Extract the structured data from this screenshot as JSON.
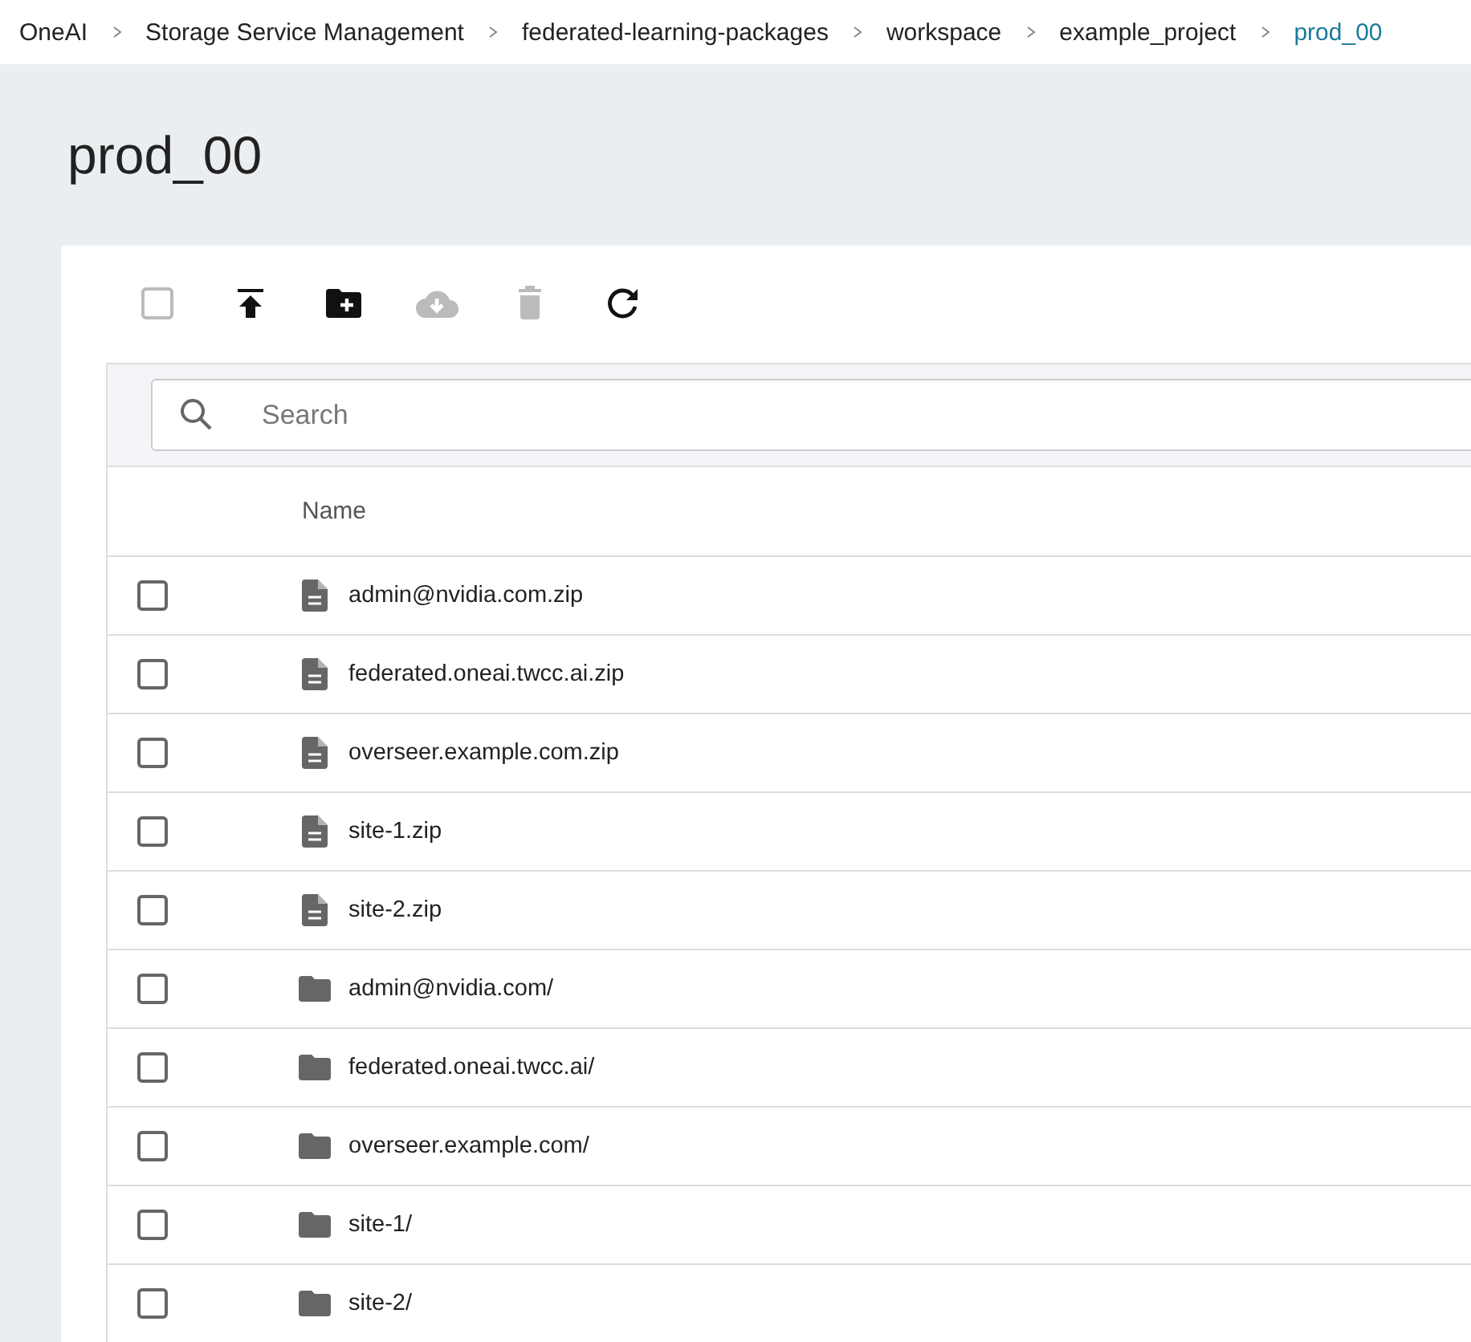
{
  "breadcrumb": [
    {
      "label": "OneAI",
      "current": false
    },
    {
      "label": "Storage Service Management",
      "current": false
    },
    {
      "label": "federated-learning-packages",
      "current": false
    },
    {
      "label": "workspace",
      "current": false
    },
    {
      "label": "example_project",
      "current": false
    },
    {
      "label": "prod_00",
      "current": true
    }
  ],
  "page_title": "prod_00",
  "toolbar": [
    {
      "kind": "select-all",
      "disabled": true,
      "checked": false
    },
    {
      "kind": "upload",
      "disabled": false
    },
    {
      "kind": "new-folder",
      "disabled": false
    },
    {
      "kind": "download",
      "disabled": true
    },
    {
      "kind": "delete",
      "disabled": true
    },
    {
      "kind": "refresh",
      "disabled": false
    }
  ],
  "search": {
    "placeholder": "Search"
  },
  "table": {
    "columns": [
      "Name"
    ],
    "rows": [
      {
        "name": "admin@nvidia.com.zip",
        "kind": "file",
        "checked": false
      },
      {
        "name": "federated.oneai.twcc.ai.zip",
        "kind": "file",
        "checked": false
      },
      {
        "name": "overseer.example.com.zip",
        "kind": "file",
        "checked": false
      },
      {
        "name": "site-1.zip",
        "kind": "file",
        "checked": false
      },
      {
        "name": "site-2.zip",
        "kind": "file",
        "checked": false
      },
      {
        "name": "admin@nvidia.com/",
        "kind": "folder",
        "checked": false
      },
      {
        "name": "federated.oneai.twcc.ai/",
        "kind": "folder",
        "checked": false
      },
      {
        "name": "overseer.example.com/",
        "kind": "folder",
        "checked": false
      },
      {
        "name": "site-1/",
        "kind": "folder",
        "checked": false
      },
      {
        "name": "site-2/",
        "kind": "folder",
        "checked": false
      }
    ]
  }
}
